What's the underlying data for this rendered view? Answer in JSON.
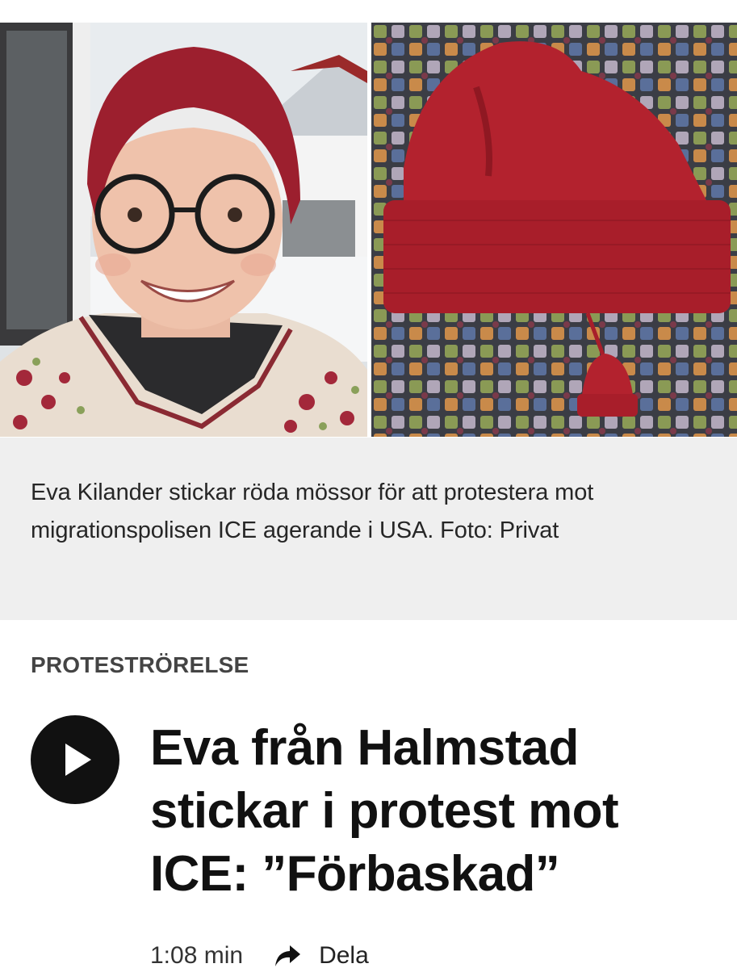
{
  "photos": {
    "left_photo": "portrait-photo",
    "right_photo": "red-hat-photo"
  },
  "caption": {
    "text": "Eva Kilander stickar röda mössor för att protestera mot migrationspolisen ICE agerande i USA. Foto: Privat"
  },
  "article": {
    "category": "PROTESTRÖRELSE",
    "headline": "Eva från Halmstad stickar i protest mot ICE: ”Förbaskad”",
    "duration": "1:08 min",
    "share_label": "Dela"
  },
  "icons": {
    "play": "play-icon",
    "share": "share-arrow-icon"
  },
  "colors": {
    "caption_bg": "#efefef",
    "play_button_bg": "#111111",
    "hat_red": "#b3222e"
  }
}
